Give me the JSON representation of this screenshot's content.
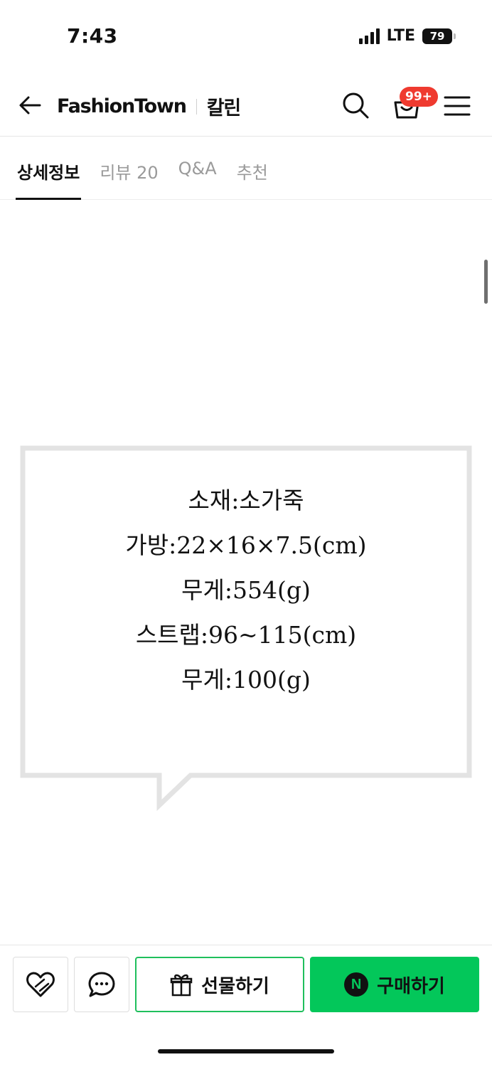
{
  "status_bar": {
    "time": "7:43",
    "network": "LTE",
    "battery": "79"
  },
  "header": {
    "brand": "FashionTown",
    "store": "칼린",
    "cart_badge": "99+"
  },
  "tabs": [
    {
      "label": "상세정보",
      "active": true
    },
    {
      "label": "리뷰 20",
      "active": false
    },
    {
      "label": "Q&A",
      "active": false
    },
    {
      "label": "추천",
      "active": false
    }
  ],
  "product_specs": [
    "소재:소가죽",
    "가방:22×16×7.5(cm)",
    "무게:554(g)",
    "스트랩:96~115(cm)",
    "무게:100(g)"
  ],
  "bottom_bar": {
    "gift_label": "선물하기",
    "buy_label": "구매하기",
    "buy_logo": "N",
    "accent_color": "#03c75a"
  },
  "icons": [
    "back-arrow-icon",
    "search-icon",
    "cart-icon",
    "menu-icon",
    "heart-icon",
    "chat-icon",
    "gift-icon"
  ]
}
